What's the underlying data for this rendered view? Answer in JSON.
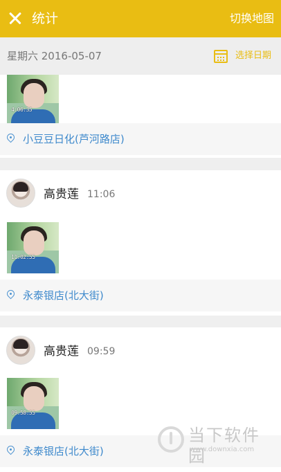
{
  "header": {
    "title": "统计",
    "switch_label": "切换地图"
  },
  "date_row": {
    "date_text": "星期六  2016-05-07",
    "pick_label": "选择日期"
  },
  "records": [
    {
      "name": "",
      "time": "",
      "photo_stamp": "4:06:35",
      "location": "小豆豆日化(芦河路店)"
    },
    {
      "name": "高贵莲",
      "time": "11:06",
      "photo_stamp": "11:02:55",
      "location": "永泰银店(北大街)"
    },
    {
      "name": "高贵莲",
      "time": "09:59",
      "photo_stamp": "09:58:55",
      "location": "永泰银店(北大街)"
    }
  ],
  "watermark": {
    "name": "当下软件园",
    "url": "www.downxia.com"
  }
}
